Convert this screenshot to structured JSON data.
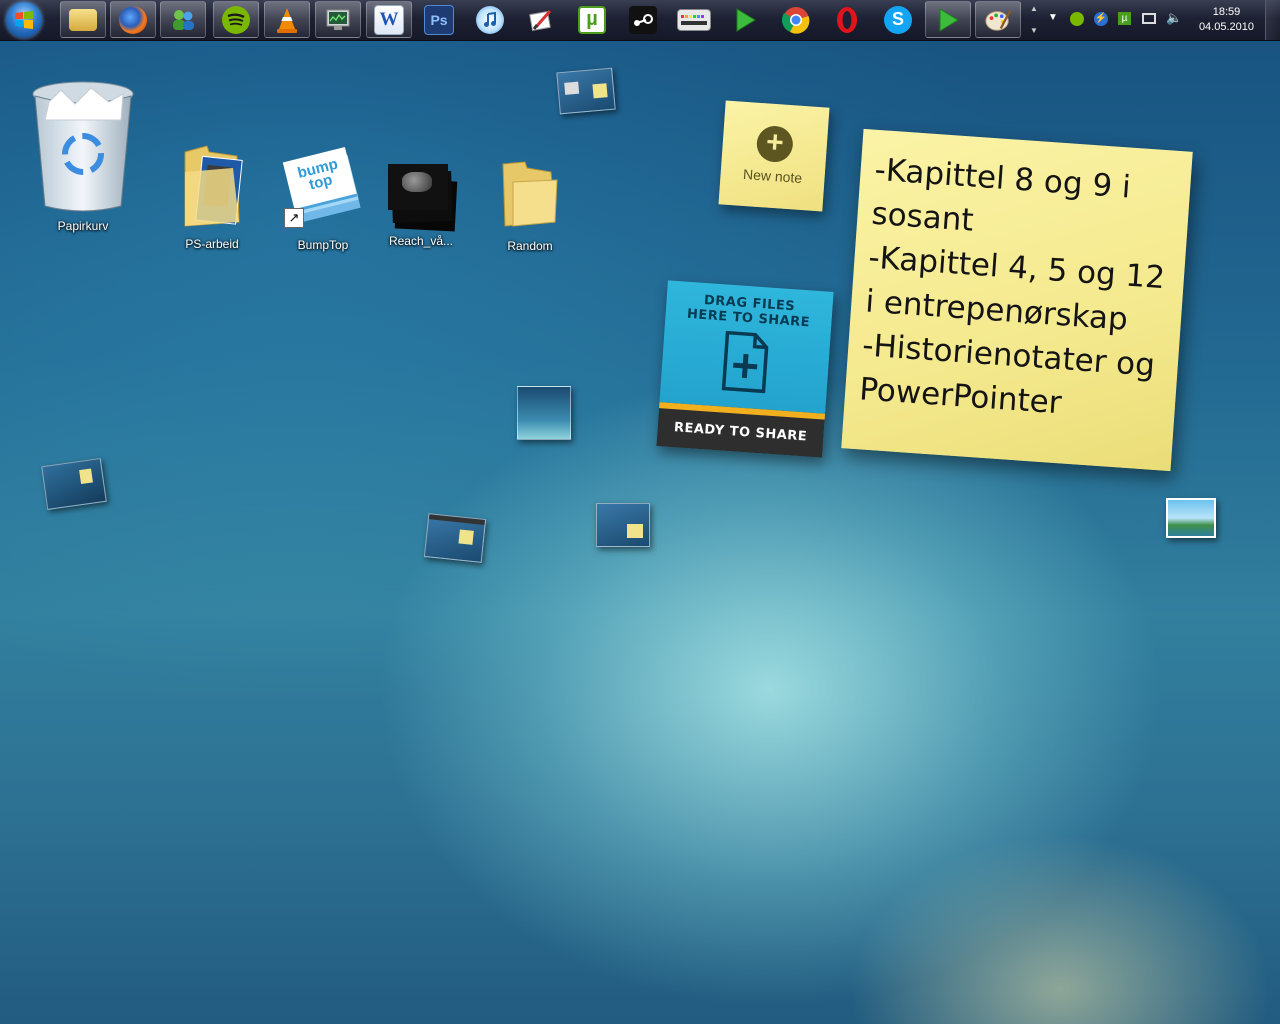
{
  "taskbar": {
    "apps": [
      {
        "name": "windows-explorer",
        "icon": "folder-icon"
      },
      {
        "name": "firefox",
        "icon": "firefox-icon"
      },
      {
        "name": "windows-live-messenger",
        "icon": "messenger-icon"
      },
      {
        "name": "spotify",
        "icon": "spotify-icon"
      },
      {
        "name": "vlc",
        "icon": "vlc-cone-icon"
      },
      {
        "name": "task-manager",
        "icon": "monitor-icon"
      },
      {
        "name": "word",
        "icon": "word-icon",
        "label": "W"
      },
      {
        "name": "photoshop",
        "icon": "photoshop-icon",
        "label": "Ps"
      },
      {
        "name": "itunes",
        "icon": "itunes-icon"
      },
      {
        "name": "paint-tool",
        "icon": "brush-icon"
      },
      {
        "name": "utorrent",
        "icon": "utorrent-icon",
        "label": "µ"
      },
      {
        "name": "steam",
        "icon": "steam-icon"
      },
      {
        "name": "audio-app",
        "icon": "equalizer-icon"
      },
      {
        "name": "media-player",
        "icon": "play-icon"
      },
      {
        "name": "chrome",
        "icon": "chrome-icon"
      },
      {
        "name": "opera",
        "icon": "opera-icon"
      },
      {
        "name": "skype",
        "icon": "skype-icon"
      },
      {
        "name": "media-player-2",
        "icon": "play-icon"
      },
      {
        "name": "paint",
        "icon": "palette-icon"
      }
    ],
    "tray": {
      "time": "18:59",
      "date": "04.05.2010"
    }
  },
  "desktop": {
    "icons": [
      {
        "label": "Papirkurv",
        "icon": "recycle-bin-icon"
      },
      {
        "label": "PS-arbeid",
        "icon": "folder-icon"
      },
      {
        "label": "BumpTop",
        "icon": "bumptop-icon"
      },
      {
        "label": "Reach_vå...",
        "icon": "image-stack-icon"
      },
      {
        "label": "Random",
        "icon": "folder-icon"
      }
    ],
    "bumptop_logo": "bump top",
    "new_note": {
      "label": "New note"
    },
    "share": {
      "top_text": "DRAG FILES HERE TO SHARE",
      "bottom_text": "READY TO SHARE"
    },
    "sticky_note": {
      "lines": [
        "-Kapittel 8 og 9 i",
        "sosant",
        "-Kapittel 4, 5 og 12",
        "i entrepenørskap",
        "-Historienotater og",
        "PowerPointer"
      ]
    }
  },
  "colors": {
    "desktop_bg": "#2a7ea7",
    "taskbar_bg": "#1d2133",
    "sticky_yellow": "#f4e98e",
    "share_blue": "#1e9cc8",
    "share_accent": "#f2b01e"
  }
}
